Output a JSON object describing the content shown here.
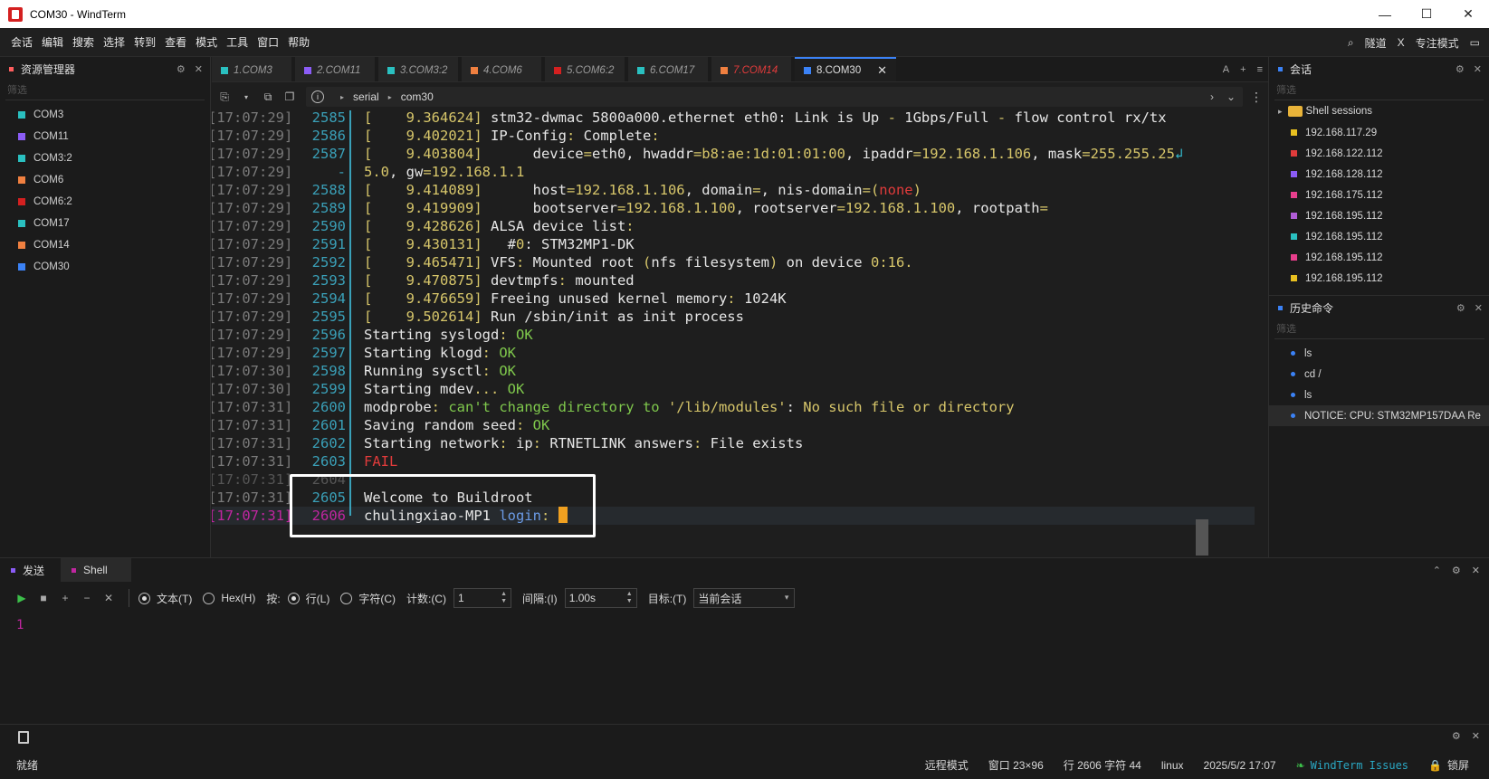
{
  "window": {
    "title": "COM30 - WindTerm",
    "min": "—",
    "max": "☐",
    "close": "✕"
  },
  "menus": [
    "会话",
    "编辑",
    "搜索",
    "选择",
    "转到",
    "查看",
    "模式",
    "工具",
    "窗口",
    "帮助"
  ],
  "menubar_right": {
    "search_icon": "⌕",
    "tunnel": "隧道",
    "x_icon": "X",
    "focus_mode": "专注模式",
    "layout_icon": "▭"
  },
  "explorer": {
    "title": "资源管理器",
    "filter_placeholder": "筛选",
    "items": [
      {
        "label": "COM3",
        "color": "#2ac0c0"
      },
      {
        "label": "COM11",
        "color": "#8b5cf6"
      },
      {
        "label": "COM3:2",
        "color": "#2ac0c0"
      },
      {
        "label": "COM6",
        "color": "#f08040"
      },
      {
        "label": "COM6:2",
        "color": "#d42020"
      },
      {
        "label": "COM17",
        "color": "#2ac0c0"
      },
      {
        "label": "COM14",
        "color": "#f08040"
      },
      {
        "label": "COM30",
        "color": "#3b82f6"
      }
    ]
  },
  "tabs": [
    {
      "label": "1.COM3",
      "color": "#2ac0c0"
    },
    {
      "label": "2.COM11",
      "color": "#8b5cf6"
    },
    {
      "label": "3.COM3:2",
      "color": "#2ac0c0"
    },
    {
      "label": "4.COM6",
      "color": "#f08040"
    },
    {
      "label": "5.COM6:2",
      "color": "#d42020"
    },
    {
      "label": "6.COM17",
      "color": "#2ac0c0"
    },
    {
      "label": "7.COM14",
      "color": "#f08040",
      "text_color": "#e03b3b"
    },
    {
      "label": "8.COM30",
      "color": "#3b82f6",
      "active": true
    }
  ],
  "tab_close": "✕",
  "tabbar_tools": {
    "font": "A",
    "add": "+",
    "list": "≡"
  },
  "path": {
    "segments": [
      "serial",
      "com30"
    ],
    "info": "i"
  },
  "terminal": {
    "lines": [
      {
        "ts": "[17:07:29]",
        "ln": "2585",
        "parts": [
          [
            "c-y",
            "[    9.364624] "
          ],
          [
            "c-w",
            "stm32-dwmac 5800a000.ethernet eth0: Link is Up "
          ],
          [
            "c-y",
            "- "
          ],
          [
            "c-w",
            "1Gbps/Full "
          ],
          [
            "c-y",
            "- "
          ],
          [
            "c-w",
            "flow control rx/tx"
          ]
        ]
      },
      {
        "ts": "[17:07:29]",
        "ln": "2586",
        "parts": [
          [
            "c-y",
            "[    9.402021] "
          ],
          [
            "c-w",
            "IP-Config"
          ],
          [
            "c-y",
            ": "
          ],
          [
            "c-w",
            "Complete"
          ],
          [
            "c-y",
            ":"
          ]
        ]
      },
      {
        "ts": "[17:07:29]",
        "ln": "2587",
        "parts": [
          [
            "c-y",
            "[    9.403804] "
          ],
          [
            "c-w",
            "     device"
          ],
          [
            "c-y",
            "="
          ],
          [
            "c-w",
            "eth0, hwaddr"
          ],
          [
            "c-y",
            "=b8:ae:1d:01:01:00"
          ],
          [
            "c-w",
            ", ipaddr"
          ],
          [
            "c-y",
            "=192.168.1.106"
          ],
          [
            "c-w",
            ", mask"
          ],
          [
            "c-y",
            "=255.255.25"
          ],
          [
            "c-cy",
            "↲"
          ]
        ]
      },
      {
        "ts": "[17:07:29]",
        "ln": "   -",
        "parts": [
          [
            "c-y",
            "5.0"
          ],
          [
            "c-w",
            ", gw"
          ],
          [
            "c-y",
            "=192.168.1.1"
          ]
        ]
      },
      {
        "ts": "[17:07:29]",
        "ln": "2588",
        "parts": [
          [
            "c-y",
            "[    9.414089] "
          ],
          [
            "c-w",
            "     host"
          ],
          [
            "c-y",
            "=192.168.1.106"
          ],
          [
            "c-w",
            ", domain"
          ],
          [
            "c-y",
            "="
          ],
          [
            "c-w",
            ", nis-domain"
          ],
          [
            "c-y",
            "=("
          ],
          [
            "c-r",
            "none"
          ],
          [
            "c-y",
            ")"
          ]
        ]
      },
      {
        "ts": "[17:07:29]",
        "ln": "2589",
        "parts": [
          [
            "c-y",
            "[    9.419909] "
          ],
          [
            "c-w",
            "     bootserver"
          ],
          [
            "c-y",
            "=192.168.1.100"
          ],
          [
            "c-w",
            ", rootserver"
          ],
          [
            "c-y",
            "=192.168.1.100"
          ],
          [
            "c-w",
            ", rootpath"
          ],
          [
            "c-y",
            "="
          ]
        ]
      },
      {
        "ts": "[17:07:29]",
        "ln": "2590",
        "parts": [
          [
            "c-y",
            "[    9.428626] "
          ],
          [
            "c-w",
            "ALSA device list"
          ],
          [
            "c-y",
            ":"
          ]
        ]
      },
      {
        "ts": "[17:07:29]",
        "ln": "2591",
        "parts": [
          [
            "c-y",
            "[    9.430131] "
          ],
          [
            "c-w",
            "  #"
          ],
          [
            "c-y",
            "0"
          ],
          [
            "c-w",
            ": STM32MP1-DK"
          ]
        ]
      },
      {
        "ts": "[17:07:29]",
        "ln": "2592",
        "parts": [
          [
            "c-y",
            "[    9.465471] "
          ],
          [
            "c-w",
            "VFS"
          ],
          [
            "c-y",
            ": "
          ],
          [
            "c-w",
            "Mounted root "
          ],
          [
            "c-y",
            "("
          ],
          [
            "c-w",
            "nfs filesystem"
          ],
          [
            "c-y",
            ") "
          ],
          [
            "c-w",
            "on device "
          ],
          [
            "c-y",
            "0:16."
          ]
        ]
      },
      {
        "ts": "[17:07:29]",
        "ln": "2593",
        "parts": [
          [
            "c-y",
            "[    9.470875] "
          ],
          [
            "c-w",
            "devtmpfs"
          ],
          [
            "c-y",
            ": "
          ],
          [
            "c-w",
            "mounted"
          ]
        ]
      },
      {
        "ts": "[17:07:29]",
        "ln": "2594",
        "parts": [
          [
            "c-y",
            "[    9.476659] "
          ],
          [
            "c-w",
            "Freeing unused kernel memory"
          ],
          [
            "c-y",
            ": "
          ],
          [
            "c-w",
            "1024K"
          ]
        ]
      },
      {
        "ts": "[17:07:29]",
        "ln": "2595",
        "parts": [
          [
            "c-y",
            "[    9.502614] "
          ],
          [
            "c-w",
            "Run /sbin/init as init process"
          ]
        ]
      },
      {
        "ts": "[17:07:29]",
        "ln": "2596",
        "parts": [
          [
            "c-w",
            "Starting syslogd"
          ],
          [
            "c-y",
            ": "
          ],
          [
            "c-g",
            "OK"
          ]
        ]
      },
      {
        "ts": "[17:07:29]",
        "ln": "2597",
        "parts": [
          [
            "c-w",
            "Starting klogd"
          ],
          [
            "c-y",
            ": "
          ],
          [
            "c-g",
            "OK"
          ]
        ]
      },
      {
        "ts": "[17:07:30]",
        "ln": "2598",
        "parts": [
          [
            "c-w",
            "Running sysctl"
          ],
          [
            "c-y",
            ": "
          ],
          [
            "c-g",
            "OK"
          ]
        ]
      },
      {
        "ts": "[17:07:30]",
        "ln": "2599",
        "parts": [
          [
            "c-w",
            "Starting mdev"
          ],
          [
            "c-y",
            "... "
          ],
          [
            "c-g",
            "OK"
          ]
        ]
      },
      {
        "ts": "[17:07:31]",
        "ln": "2600",
        "parts": [
          [
            "c-w",
            "modprobe"
          ],
          [
            "c-y",
            ": "
          ],
          [
            "c-g",
            "can't change directory to "
          ],
          [
            "c-y",
            "'/lib/modules'"
          ],
          [
            "c-w",
            ": "
          ],
          [
            "c-y",
            "No such file or directory"
          ]
        ]
      },
      {
        "ts": "[17:07:31]",
        "ln": "2601",
        "parts": [
          [
            "c-w",
            "Saving random seed"
          ],
          [
            "c-y",
            ": "
          ],
          [
            "c-g",
            "OK"
          ]
        ]
      },
      {
        "ts": "[17:07:31]",
        "ln": "2602",
        "parts": [
          [
            "c-w",
            "Starting network"
          ],
          [
            "c-y",
            ": "
          ],
          [
            "c-w",
            "ip"
          ],
          [
            "c-y",
            ": "
          ],
          [
            "c-w",
            "RTNETLINK answers"
          ],
          [
            "c-y",
            ": "
          ],
          [
            "c-w",
            "File exists"
          ]
        ]
      },
      {
        "ts": "[17:07:31]",
        "ln": "2603",
        "parts": [
          [
            "c-r",
            "FAIL"
          ]
        ]
      },
      {
        "ts": "[17:07:31]",
        "ln": "2604",
        "parts": [],
        "dim": true
      },
      {
        "ts": "[17:07:31]",
        "ln": "2605",
        "parts": [
          [
            "c-w",
            "Welcome to Buildroot"
          ]
        ]
      },
      {
        "ts": "[17:07:31]",
        "ln": "2606",
        "parts": [
          [
            "c-w",
            "chulingxiao-MP1 "
          ],
          [
            "c-b",
            "login"
          ],
          [
            "c-y",
            ": "
          ]
        ],
        "current": true
      }
    ]
  },
  "sessions": {
    "title": "会话",
    "filter_placeholder": "筛选",
    "folder": "Shell sessions",
    "hosts": [
      {
        "label": "192.168.117.29",
        "color": "#e8c020"
      },
      {
        "label": "192.168.122.112",
        "color": "#e03b3b"
      },
      {
        "label": "192.168.128.112",
        "color": "#8b5cf6"
      },
      {
        "label": "192.168.175.112",
        "color": "#e83e8c"
      },
      {
        "label": "192.168.195.112",
        "color": "#b05cd6"
      },
      {
        "label": "192.168.195.112",
        "color": "#2ac0c0"
      },
      {
        "label": "192.168.195.112",
        "color": "#e83e8c"
      },
      {
        "label": "192.168.195.112",
        "color": "#e8c020"
      }
    ]
  },
  "history": {
    "title": "历史命令",
    "filter_placeholder": "筛选",
    "items": [
      "ls",
      "cd /",
      "ls",
      "NOTICE: CPU: STM32MP157DAA Re"
    ]
  },
  "send": {
    "tabs": [
      "发送",
      "Shell"
    ],
    "buttons": {
      "play": "▶",
      "stop": "■",
      "add": "+",
      "remove": "−",
      "clear": "✕"
    },
    "text_label": "文本(T)",
    "hex_label": "Hex(H)",
    "by_label": "按:",
    "line_label": "行(L)",
    "char_label": "字符(C)",
    "count_label": "计数:(C)",
    "count_value": "1",
    "interval_label": "间隔:(I)",
    "interval_value": "1.00s",
    "target_label": "目标:(T)",
    "target_value": "当前会话",
    "editor_line": "1"
  },
  "panel_tools": {
    "gear": "⚙",
    "close": "✕",
    "up": "⌃"
  },
  "status": {
    "ready": "就绪",
    "remote_mode": "远程模式",
    "window": "窗口 23×96",
    "position": "行 2606 字符 44",
    "os": "linux",
    "datetime": "2025/5/2 17:07",
    "issues": "WindTerm Issues",
    "lock": "锁屏"
  }
}
